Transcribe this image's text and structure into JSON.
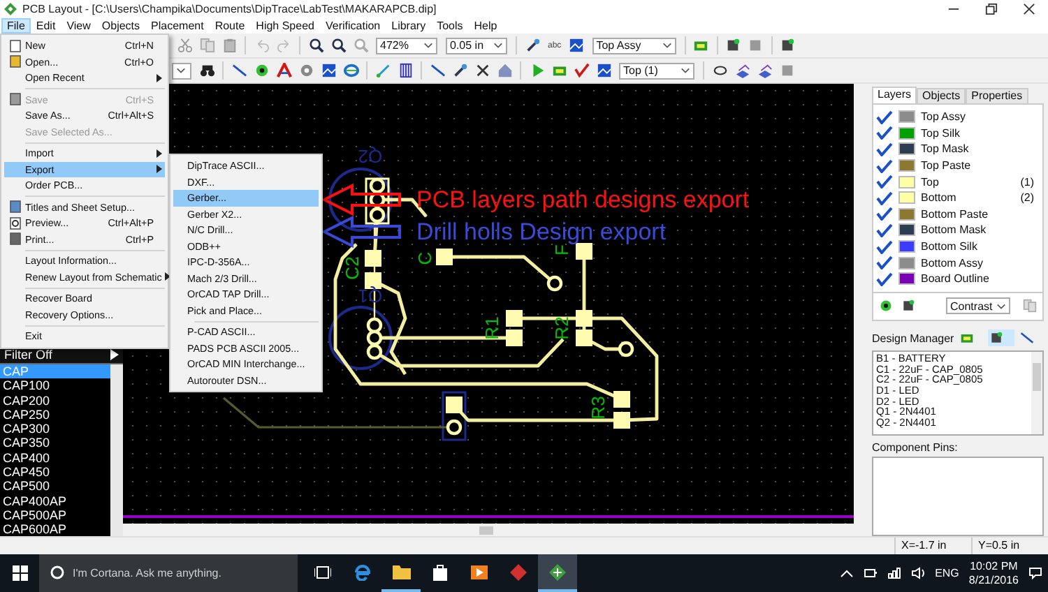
{
  "window": {
    "title": "PCB Layout - [C:\\Users\\Champika\\Documents\\DipTrace\\LabTest\\MAKARAPCB.dip]"
  },
  "menu_bar": [
    {
      "label": "File",
      "selected": true
    },
    {
      "label": "Edit",
      "selected": false
    },
    {
      "label": "View",
      "selected": false
    },
    {
      "label": "Objects",
      "selected": false
    },
    {
      "label": "Placement",
      "selected": false
    },
    {
      "label": "Route",
      "selected": false
    },
    {
      "label": "High Speed",
      "selected": false
    },
    {
      "label": "Verification",
      "selected": false
    },
    {
      "label": "Library",
      "selected": false
    },
    {
      "label": "Tools",
      "selected": false
    },
    {
      "label": "Help",
      "selected": false
    }
  ],
  "toolbar": {
    "zoom": "472%",
    "grid": "0.05 in",
    "view_layer": "Top Assy",
    "abc_label": "abc",
    "active_layer": "Top (1)"
  },
  "file_menu": [
    {
      "kind": "item",
      "label": "New",
      "shortcut": "Ctrl+N",
      "disabled": false,
      "submenu": false,
      "selected": false
    },
    {
      "kind": "item",
      "label": "Open...",
      "shortcut": "Ctrl+O",
      "disabled": false,
      "submenu": false,
      "selected": false
    },
    {
      "kind": "item",
      "label": "Open Recent",
      "disabled": false,
      "submenu": true,
      "selected": false
    },
    {
      "kind": "separator"
    },
    {
      "kind": "item",
      "label": "Save",
      "shortcut": "Ctrl+S",
      "disabled": true,
      "submenu": false,
      "selected": false
    },
    {
      "kind": "item",
      "label": "Save As...",
      "shortcut": "Ctrl+Alt+S",
      "disabled": false,
      "submenu": false,
      "selected": false
    },
    {
      "kind": "item",
      "label": "Save Selected As...",
      "disabled": true,
      "submenu": false,
      "selected": false
    },
    {
      "kind": "separator"
    },
    {
      "kind": "item",
      "label": "Import",
      "disabled": false,
      "submenu": true,
      "selected": false
    },
    {
      "kind": "item",
      "label": "Export",
      "disabled": false,
      "submenu": true,
      "selected": true
    },
    {
      "kind": "item",
      "label": "Order PCB...",
      "disabled": false,
      "submenu": false,
      "selected": false
    },
    {
      "kind": "separator"
    },
    {
      "kind": "item",
      "label": "Titles and Sheet Setup...",
      "disabled": false,
      "submenu": false,
      "selected": false
    },
    {
      "kind": "item",
      "label": "Preview...",
      "shortcut": "Ctrl+Alt+P",
      "disabled": false,
      "submenu": false,
      "selected": false
    },
    {
      "kind": "item",
      "label": "Print...",
      "shortcut": "Ctrl+P",
      "disabled": false,
      "submenu": false,
      "selected": false
    },
    {
      "kind": "separator"
    },
    {
      "kind": "item",
      "label": "Layout Information...",
      "disabled": false,
      "submenu": false,
      "selected": false
    },
    {
      "kind": "item",
      "label": "Renew Layout from Schematic",
      "disabled": false,
      "submenu": true,
      "selected": false
    },
    {
      "kind": "separator"
    },
    {
      "kind": "item",
      "label": "Recover Board",
      "disabled": false,
      "submenu": false,
      "selected": false
    },
    {
      "kind": "item",
      "label": "Recovery Options...",
      "disabled": false,
      "submenu": false,
      "selected": false
    },
    {
      "kind": "separator"
    },
    {
      "kind": "item",
      "label": "Exit",
      "disabled": false,
      "submenu": false,
      "selected": false
    }
  ],
  "export_menu": [
    {
      "kind": "item",
      "label": "DipTrace ASCII...",
      "selected": false
    },
    {
      "kind": "item",
      "label": "DXF...",
      "selected": false
    },
    {
      "kind": "item",
      "label": "Gerber...",
      "selected": true
    },
    {
      "kind": "item",
      "label": "Gerber X2...",
      "selected": false
    },
    {
      "kind": "item",
      "label": "N/C Drill...",
      "selected": false
    },
    {
      "kind": "item",
      "label": "ODB++",
      "selected": false
    },
    {
      "kind": "item",
      "label": "IPC-D-356A...",
      "selected": false
    },
    {
      "kind": "item",
      "label": "Mach 2/3 Drill...",
      "selected": false
    },
    {
      "kind": "item",
      "label": "OrCAD TAP Drill...",
      "selected": false
    },
    {
      "kind": "item",
      "label": "Pick and Place...",
      "selected": false
    },
    {
      "kind": "separator"
    },
    {
      "kind": "item",
      "label": "P-CAD ASCII...",
      "selected": false
    },
    {
      "kind": "item",
      "label": "PADS PCB ASCII 2005...",
      "selected": false
    },
    {
      "kind": "item",
      "label": "OrCAD MIN Interchange...",
      "selected": false
    },
    {
      "kind": "item",
      "label": "Autorouter DSN...",
      "selected": false
    }
  ],
  "annotations": [
    {
      "text": "PCB layers path designs export",
      "color": "#ff1010"
    },
    {
      "text": "Drill holls Design export",
      "color": "#3a4ad8"
    }
  ],
  "pcb_labels": [
    {
      "text": "Q2",
      "color": "#1c2a8c"
    },
    {
      "text": "C2",
      "color": "#00c000"
    },
    {
      "text": "Q1",
      "color": "#1c2a8c"
    },
    {
      "text": "C",
      "color": "#00c000"
    },
    {
      "text": "F",
      "color": "#00c000"
    },
    {
      "text": "R1",
      "color": "#00c000"
    },
    {
      "text": "R2",
      "color": "#00c000"
    },
    {
      "text": "R3",
      "color": "#00c000"
    }
  ],
  "filter_list": {
    "filter": "Filter Off",
    "items": [
      {
        "label": "CAP",
        "selected": true
      },
      {
        "label": "CAP100",
        "selected": false
      },
      {
        "label": "CAP200",
        "selected": false
      },
      {
        "label": "CAP250",
        "selected": false
      },
      {
        "label": "CAP300",
        "selected": false
      },
      {
        "label": "CAP350",
        "selected": false
      },
      {
        "label": "CAP400",
        "selected": false
      },
      {
        "label": "CAP450",
        "selected": false
      },
      {
        "label": "CAP500",
        "selected": false
      },
      {
        "label": "CAP400AP",
        "selected": false
      },
      {
        "label": "CAP500AP",
        "selected": false
      },
      {
        "label": "CAP600AP",
        "selected": false
      }
    ]
  },
  "side_panel": {
    "tabs": [
      {
        "label": "Layers",
        "selected": true
      },
      {
        "label": "Objects",
        "selected": false
      },
      {
        "label": "Properties",
        "selected": false
      }
    ],
    "layers": [
      {
        "name": "Top Assy",
        "checked": true,
        "color": "#8c8c8c"
      },
      {
        "name": "Top Silk",
        "checked": true,
        "color": "#00a000"
      },
      {
        "name": "Top Mask",
        "checked": true,
        "color": "#2c3e50"
      },
      {
        "name": "Top Paste",
        "checked": true,
        "color": "#8c7830"
      },
      {
        "name": "Top",
        "checked": true,
        "color": "#ffffa8",
        "count": "(1)"
      },
      {
        "name": "Bottom",
        "checked": true,
        "color": "#ffffa8",
        "count": "(2)"
      },
      {
        "name": "Bottom Paste",
        "checked": true,
        "color": "#8c7830"
      },
      {
        "name": "Bottom Mask",
        "checked": true,
        "color": "#2c3e50"
      },
      {
        "name": "Bottom Silk",
        "checked": true,
        "color": "#3c3cff"
      },
      {
        "name": "Bottom Assy",
        "checked": true,
        "color": "#8c8c8c"
      },
      {
        "name": "Board Outline",
        "checked": true,
        "color": "#7a00b4"
      }
    ],
    "contrast": "Contrast",
    "design_manager": "Design Manager",
    "components": [
      "B1 - BATTERY",
      "C1 - 22uF - CAP_0805",
      "C2 - 22uF - CAP_0805",
      "D1 - LED",
      "D2 - LED",
      "Q1 - 2N4401",
      "Q2 - 2N4401"
    ],
    "pins_label": "Component Pins:"
  },
  "status_bar": {
    "x": "X=-1.7 in",
    "y": "Y=0.5 in"
  },
  "taskbar": {
    "search_placeholder": "I'm Cortana. Ask me anything.",
    "apps": [
      {
        "kind": "taskview",
        "running": false,
        "selected": false
      },
      {
        "kind": "browser",
        "running": false,
        "selected": false
      },
      {
        "kind": "folder",
        "running": true,
        "selected": false
      },
      {
        "kind": "store",
        "running": false,
        "selected": false
      },
      {
        "kind": "media",
        "running": false,
        "selected": false
      },
      {
        "kind": "redapp",
        "running": false,
        "selected": false
      },
      {
        "kind": "pcbapp",
        "running": true,
        "selected": true
      }
    ],
    "language": "ENG",
    "time": "10:02 PM",
    "date": "8/21/2016"
  }
}
